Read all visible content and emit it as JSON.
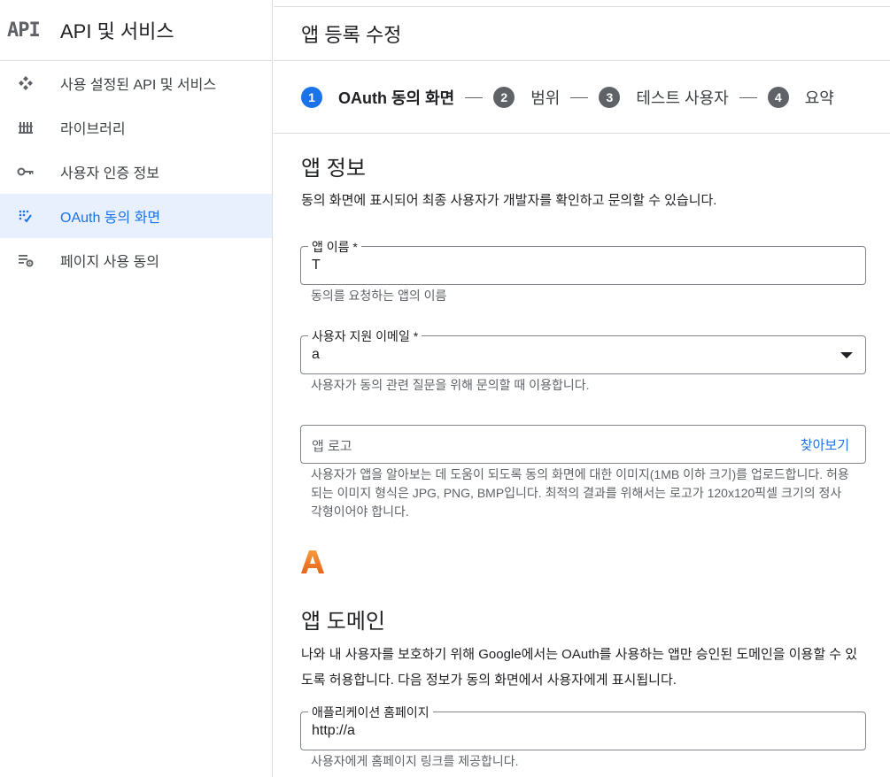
{
  "sidebar": {
    "logo": "API",
    "title": "API 및 서비스",
    "items": [
      {
        "label": "사용 설정된 API 및 서비스",
        "icon": "api-services-icon",
        "active": false
      },
      {
        "label": "라이브러리",
        "icon": "library-icon",
        "active": false
      },
      {
        "label": "사용자 인증 정보",
        "icon": "key-icon",
        "active": false
      },
      {
        "label": "OAuth 동의 화면",
        "icon": "consent-screen-icon",
        "active": true
      },
      {
        "label": "페이지 사용 동의",
        "icon": "page-settings-icon",
        "active": false
      }
    ]
  },
  "header": {
    "title": "앱 등록 수정"
  },
  "stepper": {
    "steps": [
      {
        "num": "1",
        "label": "OAuth 동의 화면",
        "active": true
      },
      {
        "num": "2",
        "label": "범위",
        "active": false
      },
      {
        "num": "3",
        "label": "테스트 사용자",
        "active": false
      },
      {
        "num": "4",
        "label": "요약",
        "active": false
      }
    ]
  },
  "app_info": {
    "title": "앱 정보",
    "description": "동의 화면에 표시되어 최종 사용자가 개발자를 확인하고 문의할 수 있습니다.",
    "app_name": {
      "label": "앱 이름 *",
      "value": "T",
      "hint": "동의를 요청하는 앱의 이름"
    },
    "support_email": {
      "label": "사용자 지원 이메일 *",
      "value": "a",
      "hint": "사용자가 동의 관련 질문을 위해 문의할 때 이용합니다."
    },
    "app_logo": {
      "placeholder": "앱 로고",
      "browse_label": "찾아보기",
      "hint": "사용자가 앱을 알아보는 데 도움이 되도록 동의 화면에 대한 이미지(1MB 이하 크기)를 업로드합니다. 허용되는 이미지 형식은 JPG, PNG, BMP입니다. 최적의 결과를 위해서는 로고가 120x120픽셀 크기의 정사각형이어야 합니다.",
      "preview_icon": "app-logo-a-icon",
      "preview_color": "#f07b22"
    }
  },
  "app_domain": {
    "title": "앱 도메인",
    "description": "나와 내 사용자를 보호하기 위해 Google에서는 OAuth를 사용하는 앱만 승인된 도메인을 이용할 수 있도록 허용합니다. 다음 정보가 동의 화면에서 사용자에게 표시됩니다.",
    "homepage": {
      "label": "애플리케이션 홈페이지",
      "value": "http://a",
      "hint": "사용자에게 홈페이지 링크를 제공합니다."
    }
  },
  "colors": {
    "accent": "#1a73e8",
    "active_bg": "#e8f0fe",
    "border": "#dadce0"
  }
}
